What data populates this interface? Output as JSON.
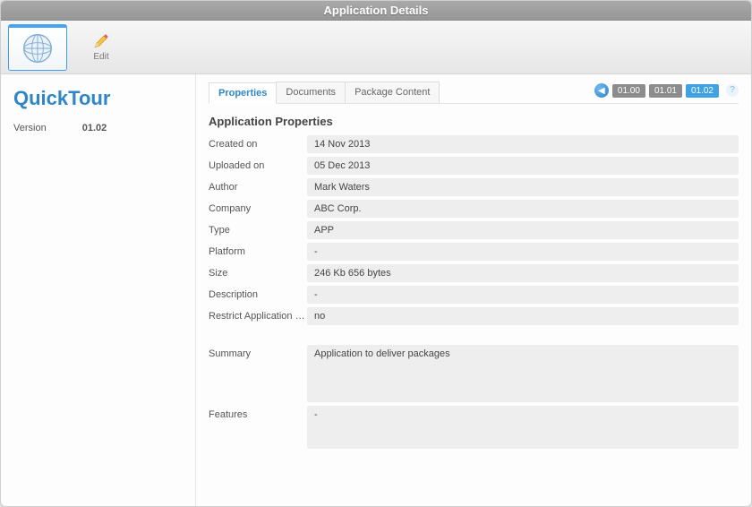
{
  "window": {
    "title": "Application Details"
  },
  "toolbar": {
    "edit_label": "Edit"
  },
  "sidebar": {
    "app_name": "QuickTour",
    "version_label": "Version",
    "version_value": "01.02"
  },
  "tabs": {
    "properties": "Properties",
    "documents": "Documents",
    "package_content": "Package Content"
  },
  "versions": [
    "01.00",
    "01.01",
    "01.02"
  ],
  "active_version": "01.02",
  "section_title": "Application Properties",
  "props": {
    "created_on": {
      "label": "Created on",
      "value": "14 Nov 2013"
    },
    "uploaded_on": {
      "label": "Uploaded on",
      "value": "05 Dec 2013"
    },
    "author": {
      "label": "Author",
      "value": "Mark Waters"
    },
    "company": {
      "label": "Company",
      "value": "ABC Corp."
    },
    "type": {
      "label": "Type",
      "value": "APP"
    },
    "platform": {
      "label": "Platform",
      "value": "-"
    },
    "size": {
      "label": "Size",
      "value": "246 Kb 656 bytes"
    },
    "description": {
      "label": "Description",
      "value": "-"
    },
    "restrict": {
      "label": "Restrict Application to...",
      "value": "no"
    },
    "summary": {
      "label": "Summary",
      "value": "Application to deliver packages"
    },
    "features": {
      "label": "Features",
      "value": "-"
    }
  }
}
